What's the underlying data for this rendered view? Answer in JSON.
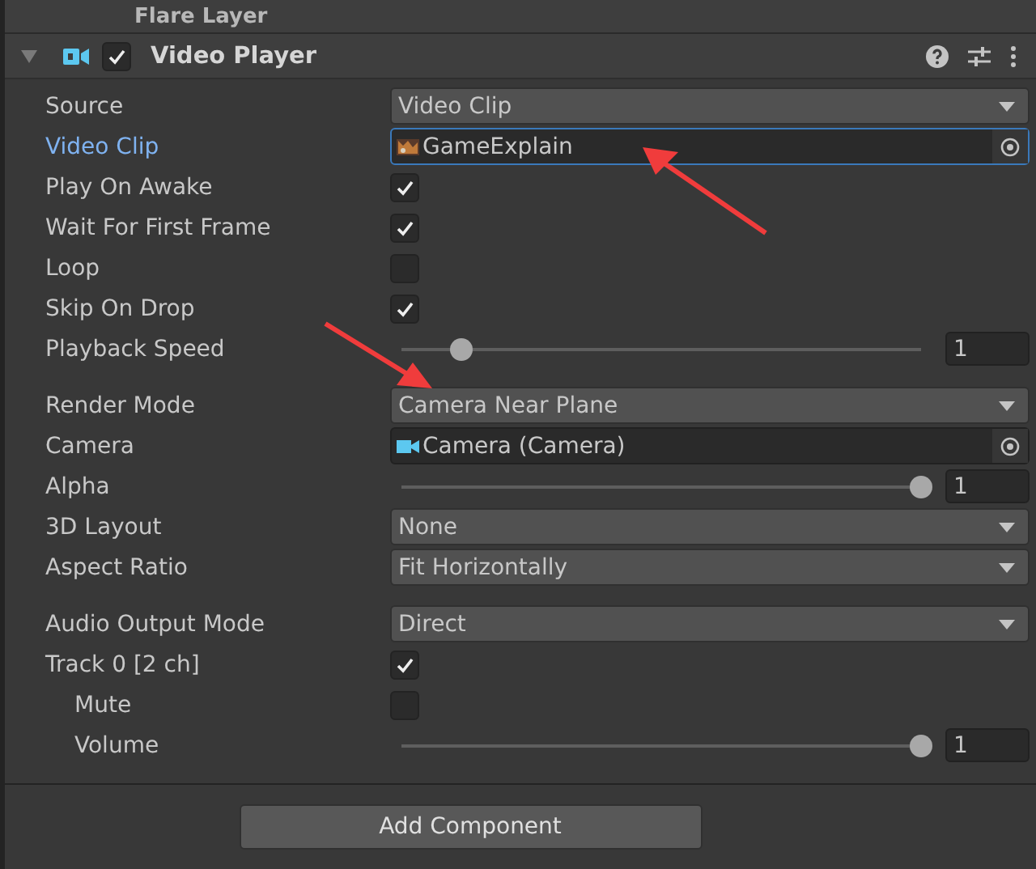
{
  "previous_component": {
    "title": "Flare Layer"
  },
  "component": {
    "title": "Video Player",
    "enabled": true,
    "expanded": true
  },
  "groups": [
    [
      {
        "label": "Source",
        "kind": "dropdown",
        "value": "Video Clip"
      },
      {
        "label": "Video Clip",
        "kind": "object",
        "value": "GameExplain",
        "focused": true
      },
      {
        "label": "Play On Awake",
        "kind": "checkbox",
        "checked": true
      },
      {
        "label": "Wait For First Frame",
        "kind": "checkbox",
        "checked": true
      },
      {
        "label": "Loop",
        "kind": "checkbox",
        "checked": false
      },
      {
        "label": "Skip On Drop",
        "kind": "checkbox",
        "checked": true
      },
      {
        "label": "Playback Speed",
        "kind": "slider",
        "level": 0.115,
        "value": "1"
      }
    ],
    [
      {
        "label": "Render Mode",
        "kind": "dropdown",
        "value": "Camera Near Plane"
      },
      {
        "label": "Camera",
        "kind": "object",
        "value": "Camera (Camera)",
        "focused": false
      },
      {
        "label": "Alpha",
        "kind": "slider",
        "level": 1,
        "value": "1"
      },
      {
        "label": "3D Layout",
        "kind": "dropdown",
        "value": "None"
      },
      {
        "label": "Aspect Ratio",
        "kind": "dropdown",
        "value": "Fit Horizontally"
      }
    ],
    [
      {
        "label": "Audio Output Mode",
        "kind": "dropdown",
        "value": "Direct"
      },
      {
        "label": "Track 0 [2 ch]",
        "kind": "checkbox",
        "checked": true,
        "children": [
          {
            "label": "Mute",
            "kind": "checkbox",
            "checked": false
          },
          {
            "label": "Volume",
            "kind": "slider",
            "level": 1,
            "value": "1"
          }
        ]
      }
    ]
  ],
  "add_button": "Add Component"
}
